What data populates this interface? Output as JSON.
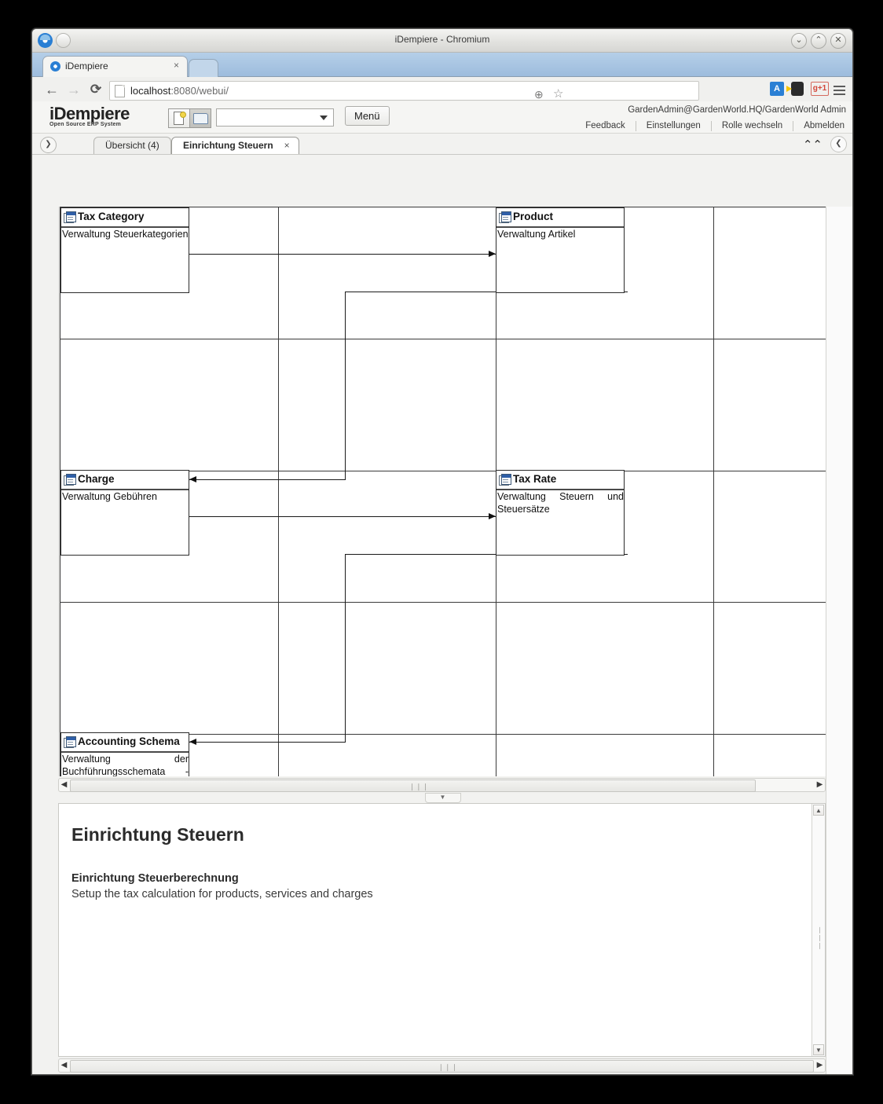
{
  "window": {
    "title": "iDempiere - Chromium",
    "minimize": "⌄",
    "maximize": "⌃",
    "close": "✕"
  },
  "browser": {
    "tab_title": "iDempiere",
    "tab_close": "×",
    "back": "←",
    "forward": "→",
    "reload": "⟳",
    "url_host": "localhost",
    "url_rest": ":8080/webui/",
    "zoom_icon": "⊕",
    "star_icon": "☆",
    "translate_icon": "A",
    "gplus_icon": "g+1"
  },
  "app": {
    "brand_main": "iDempiere",
    "brand_sub": "Open Source  ERP System",
    "menu_button": "Menü",
    "combo_value": "",
    "combo_placeholder": "",
    "user": "GardenAdmin@GardenWorld.HQ/GardenWorld Admin",
    "links": [
      {
        "label": "Feedback"
      },
      {
        "label": "Einstellungen"
      },
      {
        "label": "Rolle wechseln"
      },
      {
        "label": "Abmelden"
      }
    ],
    "tabs": [
      {
        "label": "Übersicht (4)",
        "active": false
      },
      {
        "label": "Einrichtung Steuern",
        "active": true,
        "close": "×"
      }
    ],
    "collapse_left": "❯",
    "collapse_up": "⌃⌃",
    "collapse_right": "❮"
  },
  "diagram": {
    "nodes": [
      {
        "id": "tax-category",
        "title": "Tax Category",
        "description": "Verwaltung Steuerkategorien",
        "justify": false
      },
      {
        "id": "product",
        "title": "Product",
        "description": "Verwaltung Artikel",
        "justify": false
      },
      {
        "id": "charge",
        "title": "Charge",
        "description": "Verwaltung Gebühren",
        "justify": true
      },
      {
        "id": "tax-rate",
        "title": "Tax Rate",
        "description": "Verwaltung Steuern und Steuersätze",
        "justify": true
      },
      {
        "id": "accounting-schema",
        "title": "Accounting Schema",
        "description": "Verwaltung der Buchführungsschemata - Damit Änderungen wirksam werden, melden Sie sich bitte",
        "justify": true
      }
    ]
  },
  "scrollbars": {
    "left_arrow": "◀",
    "right_arrow": "▶",
    "up_arrow": "▲",
    "down_arrow": "▼",
    "grip": "❘❘❘",
    "split_handle": "▼"
  },
  "info": {
    "heading": "Einrichtung Steuern",
    "subheading": "Einrichtung Steuerberechnung",
    "body": "Setup the tax calculation for products, services and charges"
  }
}
